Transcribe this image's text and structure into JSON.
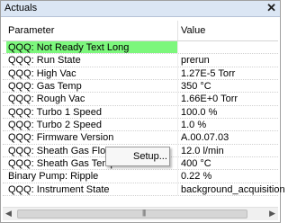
{
  "panel": {
    "title": "Actuals",
    "close_glyph": "✕"
  },
  "table": {
    "headers": [
      "Parameter",
      "Value"
    ],
    "rows": [
      {
        "param": "QQQ:  Not Ready Text Long",
        "value": "",
        "highlight": true
      },
      {
        "param": "QQQ:  Run State",
        "value": "prerun"
      },
      {
        "param": "QQQ:  High Vac",
        "value": "1.27E-5 Torr"
      },
      {
        "param": "QQQ:  Gas Temp",
        "value": "350 °C"
      },
      {
        "param": "QQQ:  Rough Vac",
        "value": "1.66E+0 Torr"
      },
      {
        "param": "QQQ:  Turbo 1 Speed",
        "value": "100.0 %"
      },
      {
        "param": "QQQ:  Turbo 2 Speed",
        "value": "1.0 %"
      },
      {
        "param": "QQQ:  Firmware Version",
        "value": "A.00.07.03"
      },
      {
        "param": "QQQ:  Sheath Gas Flow",
        "value": "12.0 l/min"
      },
      {
        "param": "QQQ:  Sheath Gas Temp",
        "value": "400 °C"
      },
      {
        "param": "Binary Pump:  Ripple",
        "value": "0.22 %"
      },
      {
        "param": "QQQ:  Instrument State",
        "value": "background_acquisition"
      }
    ]
  },
  "context_menu": {
    "items": [
      "Setup..."
    ]
  },
  "scrollbar": {
    "left_arrow": "◀",
    "right_arrow": "▶",
    "grip": "|||"
  },
  "colors": {
    "highlight": "#7cf77c",
    "titlebar": "#dbe6f4"
  }
}
